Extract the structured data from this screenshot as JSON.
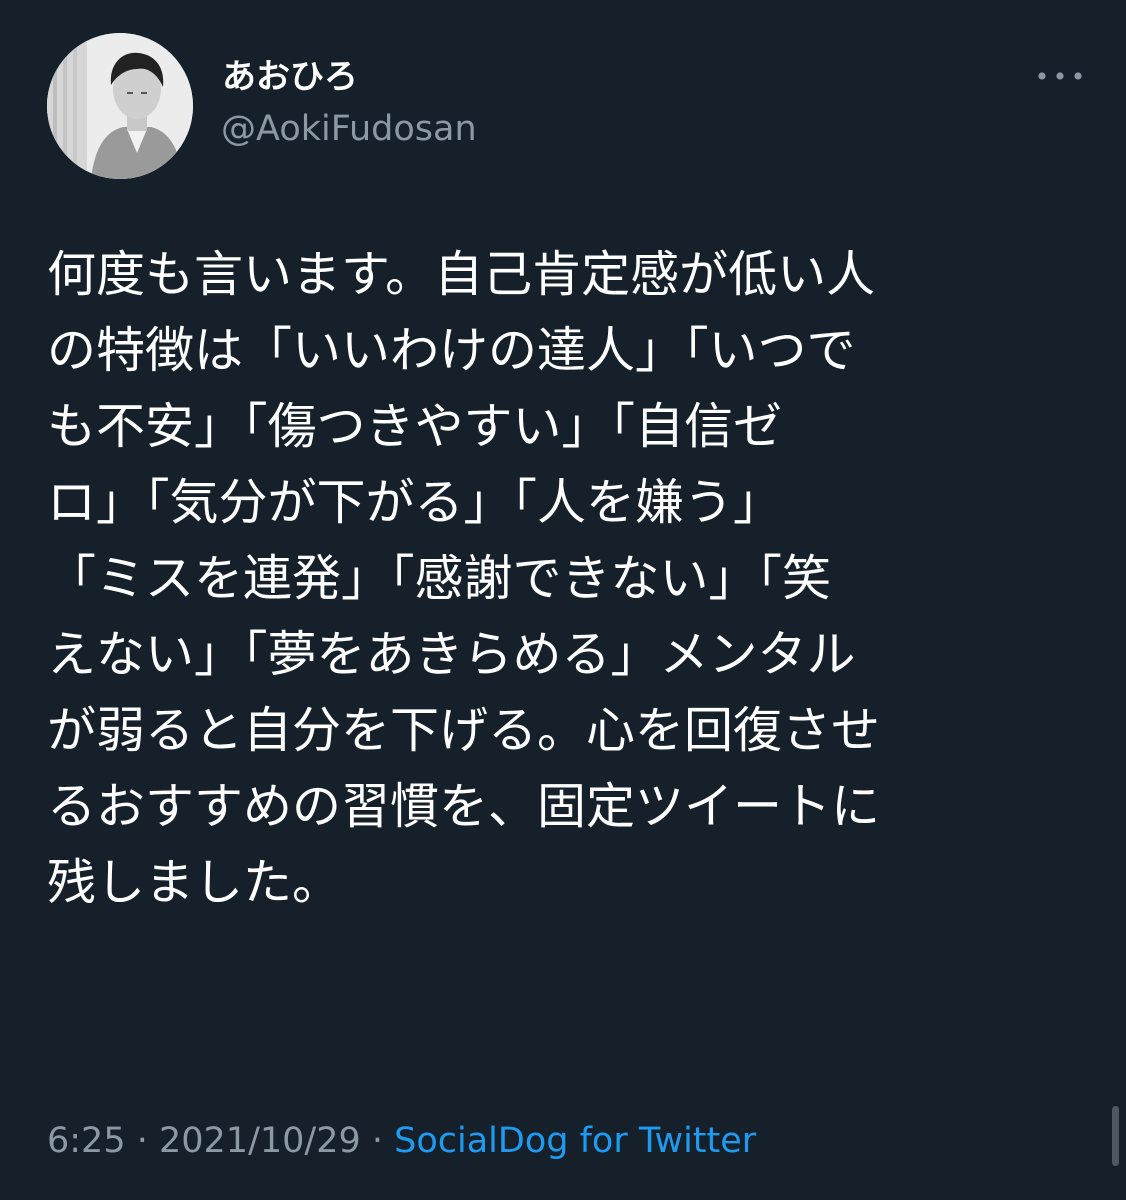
{
  "user": {
    "display_name": "あおひろ",
    "handle": "@AokiFudosan"
  },
  "tweet": {
    "lines": [
      "何度も言います。自己肯定感が低い人",
      "の特徴は「いいわけの達人」「いつで",
      "も不安」「傷つきやすい」「自信ゼ",
      "ロ」「気分が下がる」「人を嫌う」",
      "「ミスを連発」「感謝できない」「笑",
      "えない」「夢をあきらめる」メンタル",
      "が弱ると自分を下げる。心を回復させ",
      "るおすすめの習慣を、固定ツイートに",
      "残しました。"
    ]
  },
  "meta": {
    "time": "6:25",
    "separator": " · ",
    "date": "2021/10/29",
    "source": "SocialDog for Twitter"
  },
  "icons": {
    "more": "more-horizontal-icon",
    "avatar": "profile-photo"
  },
  "colors": {
    "background": "#15202b",
    "text": "#ffffff",
    "secondary": "#8b98a5",
    "link": "#1d9bf0"
  }
}
